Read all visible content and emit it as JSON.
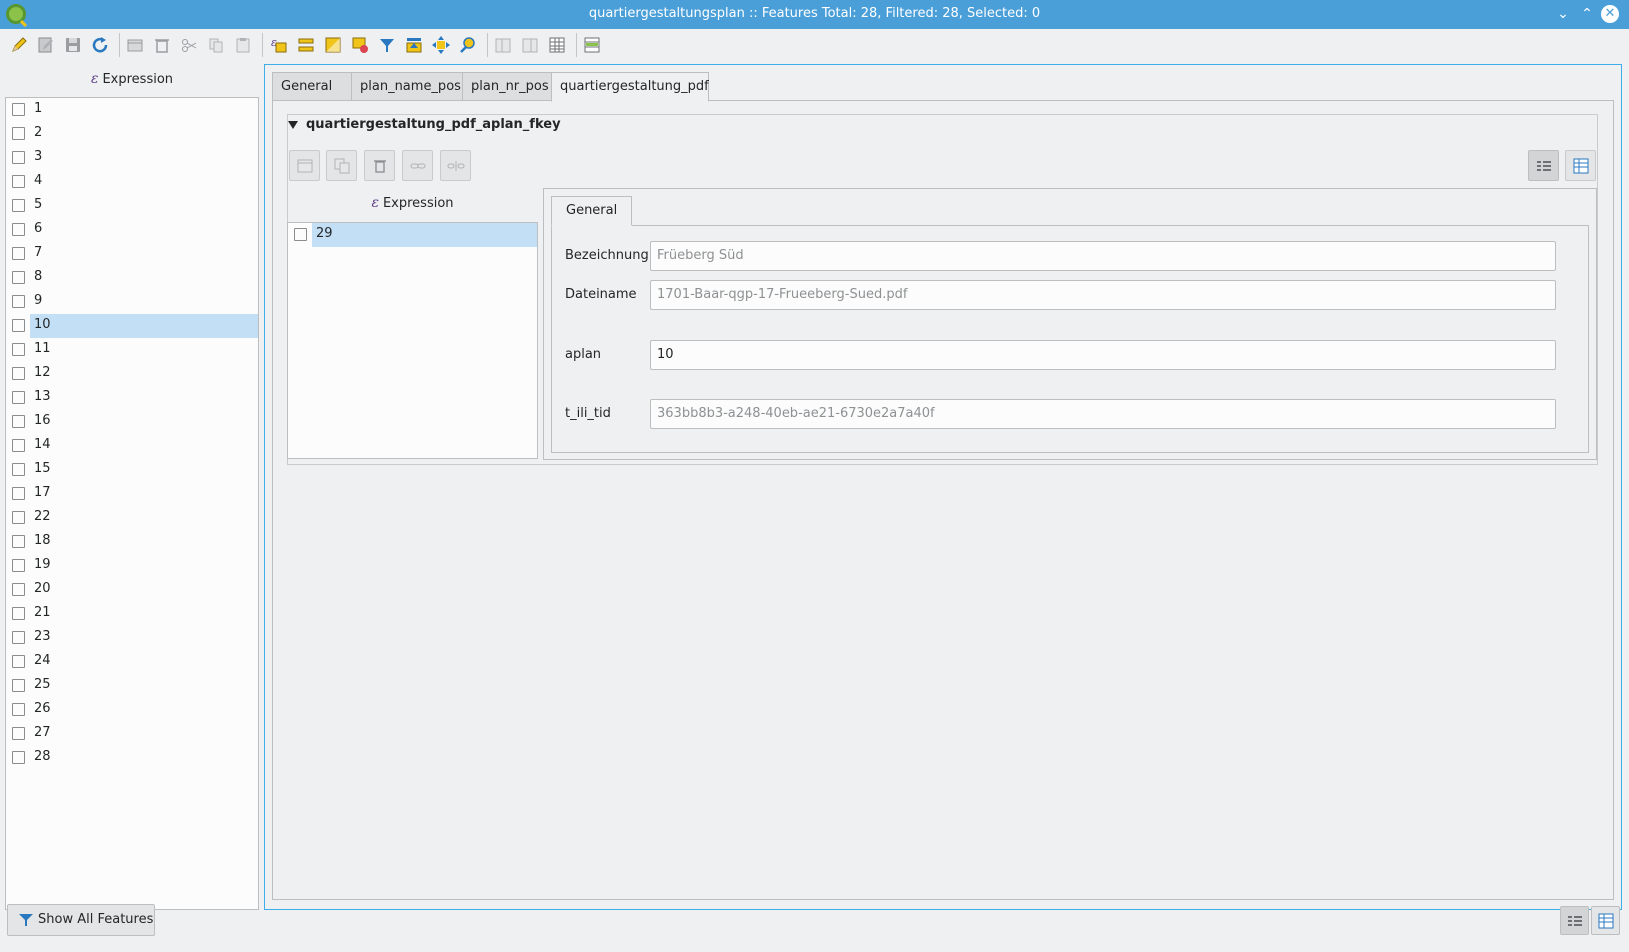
{
  "window": {
    "title": "quartiergestaltungsplan :: Features Total: 28, Filtered: 28, Selected: 0",
    "minimize_glyph": "⌄",
    "maximize_glyph": "⌃",
    "close_glyph": "✕"
  },
  "toolbar": {
    "icons": [
      "pencil-icon",
      "multi-edit-icon",
      "save-icon",
      "reload-icon",
      "add-feature-icon",
      "delete-icon",
      "cut-icon",
      "copy-icon",
      "paste-icon",
      "select-expression-icon",
      "select-all-icon",
      "invert-selection-icon",
      "deselect-icon",
      "filter-icon",
      "move-top-icon",
      "pan-icon",
      "zoom-icon",
      "new-field-icon",
      "delete-field-icon",
      "field-calculator-icon",
      "conditional-format-icon"
    ]
  },
  "left": {
    "expression_label": "Expression",
    "expression_glyph": "ε",
    "features": [
      "1",
      "2",
      "3",
      "4",
      "5",
      "6",
      "7",
      "8",
      "9",
      "10",
      "11",
      "12",
      "13",
      "16",
      "14",
      "15",
      "17",
      "22",
      "18",
      "19",
      "20",
      "21",
      "23",
      "24",
      "25",
      "26",
      "27",
      "28"
    ],
    "selected_feature": "10"
  },
  "tabs": [
    "General",
    "plan_name_pos",
    "plan_nr_pos",
    "quartiergestaltung_pdf"
  ],
  "active_tab": "quartiergestaltung_pdf",
  "relation": {
    "title": "quartiergestaltung_pdf_aplan_fkey",
    "expression_label": "Expression",
    "expression_glyph": "ε",
    "features": [
      "29"
    ],
    "selected_feature": "29",
    "form_tab": "General",
    "fields": [
      {
        "label": "Bezeichnung",
        "value": "Früeberg Süd",
        "editable": false
      },
      {
        "label": "Dateiname",
        "value": "1701-Baar-qgp-17-Frueeberg-Sued.pdf",
        "editable": false
      },
      {
        "label": "aplan",
        "value": "10",
        "editable": true
      },
      {
        "label": "t_ili_tid",
        "value": "363bb8b3-a248-40eb-ae21-6730e2a7a40f",
        "editable": false
      }
    ]
  },
  "bottom": {
    "show_all_label": "Show All Features"
  },
  "colors": {
    "titlebar": "#4a9fd8",
    "selection": "#c2dff5",
    "focus_border": "#3daee9"
  }
}
